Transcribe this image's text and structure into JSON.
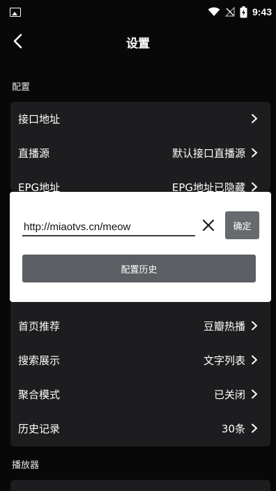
{
  "status_bar": {
    "time": "9:43",
    "icons": [
      "image-icon",
      "wifi-icon",
      "no-signal-icon",
      "battery-charging-icon"
    ]
  },
  "header": {
    "title": "设置",
    "back_icon": "chevron-left-icon"
  },
  "sections": {
    "config_label": "配置",
    "player_label": "播放器"
  },
  "rows_top": [
    {
      "label": "接口地址",
      "value": ""
    },
    {
      "label": "直播源",
      "value": "默认接口直播源"
    },
    {
      "label": "EPG地址",
      "value": "EPG地址已隐藏"
    }
  ],
  "rows_bottom": [
    {
      "label": "首页推荐",
      "value": "豆瓣热播"
    },
    {
      "label": "搜索展示",
      "value": "文字列表"
    },
    {
      "label": "聚合模式",
      "value": "已关闭"
    },
    {
      "label": "历史记录",
      "value": "30条"
    }
  ],
  "dialog": {
    "url_value": "http://miaotvs.cn/meow",
    "confirm_label": "确定",
    "history_label": "配置历史",
    "clear_icon": "close-icon"
  },
  "colors": {
    "background": "#080808",
    "card": "#1d1d1f",
    "dialog_bg": "#ffffff",
    "button": "#5b5e62"
  }
}
